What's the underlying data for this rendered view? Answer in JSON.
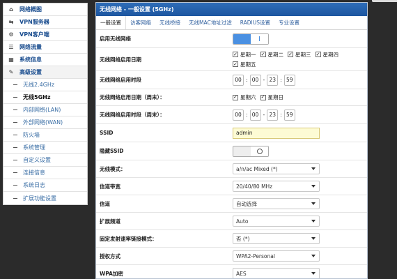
{
  "sidebar": {
    "items": [
      {
        "label": "网络概图",
        "icon": "home-icon"
      },
      {
        "label": "VPN服务器",
        "icon": "arrows-icon"
      },
      {
        "label": "VPN客户端",
        "icon": "gear-icon"
      },
      {
        "label": "网络流量",
        "icon": "list-icon"
      },
      {
        "label": "系统信息",
        "icon": "grid-icon"
      },
      {
        "label": "高级设置",
        "icon": "wrench-icon"
      }
    ],
    "subitems": [
      {
        "label": "无线2.4GHz"
      },
      {
        "label": "无线5GHz"
      },
      {
        "label": "内部网络(LAN)"
      },
      {
        "label": "外部网络(WAN)"
      },
      {
        "label": "防火墙"
      },
      {
        "label": "系统管理"
      },
      {
        "label": "自定义设置"
      },
      {
        "label": "连接信息"
      },
      {
        "label": "系统日志"
      },
      {
        "label": "扩展功能设置"
      }
    ]
  },
  "panel": {
    "title": "无线网络 - 一般设置 (5GHz)",
    "tabs": [
      "一般设置",
      "访客网络",
      "无线桥接",
      "无线MAC地址过滤",
      "RADIUS设置",
      "专业设置"
    ]
  },
  "form": {
    "enable_label": "启用无线网络",
    "days_label": "无线网络启用日期",
    "days": [
      "星期一",
      "星期二",
      "星期三",
      "星期四",
      "星期五"
    ],
    "time_label": "无线网络启用时段",
    "time": [
      "00",
      "00",
      "23",
      "59"
    ],
    "weekend_days_label": "无线网络启用日期（周末）：",
    "weekend_days": [
      "星期六",
      "星期日"
    ],
    "weekend_time_label": "无线网络启用时段（周末）：",
    "weekend_time": [
      "00",
      "00",
      "23",
      "59"
    ],
    "ssid_label": "SSID",
    "ssid_value": "admin",
    "hide_ssid_label": "隐藏SSID",
    "mode_label": "无线模式：",
    "mode_value": "a/n/ac Mixed (*)",
    "bandwidth_label": "信道带宽",
    "bandwidth_value": "20/40/80 MHz",
    "channel_label": "信道",
    "channel_value": "自动选择",
    "ext_channel_label": "扩展频道",
    "ext_channel_value": "Auto",
    "fixed_rate_label": "固定发射速率链接模式：",
    "fixed_rate_value": "否 (*)",
    "auth_label": "授权方式",
    "auth_value": "WPA2-Personal",
    "wpa_enc_label": "WPA加密",
    "wpa_enc_value": "AES"
  }
}
